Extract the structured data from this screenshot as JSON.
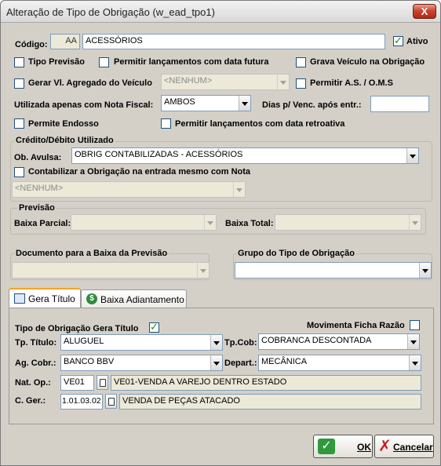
{
  "window": {
    "title": "Alteração de Tipo de Obrigação (w_ead_tpo1)",
    "close_glyph": "X"
  },
  "codigo": {
    "label": "Código:",
    "code": "AA",
    "description": "ACESSÓRIOS"
  },
  "ativo": {
    "label": "Ativo",
    "checked": true
  },
  "checks_row1": {
    "tipo_previsao": {
      "label": "Tipo Previsão",
      "checked": false
    },
    "permitir_futura": {
      "label": "Permitir lançamentos com data futura",
      "checked": false
    },
    "grava_veiculo": {
      "label": "Grava Veículo na Obrigação",
      "checked": false
    }
  },
  "gerar_vl": {
    "label": "Gerar Vl. Agregado do Veículo",
    "checked": false,
    "combo_value": "<NENHUM>"
  },
  "permitir_as": {
    "label": "Permitir A.S. / O.M.S",
    "checked": false
  },
  "nota_fiscal": {
    "label": "Utilizada apenas com Nota Fiscal:",
    "value": "AMBOS"
  },
  "dias_venc": {
    "label": "Dias p/ Venc. após entr.:",
    "value": ""
  },
  "permite_endosso": {
    "label": "Permite Endosso",
    "checked": false
  },
  "permitir_retroativa": {
    "label": "Permitir lançamentos com data retroativa",
    "checked": false
  },
  "credito": {
    "group_label": "Crédito/Débito Utilizado",
    "ob_avulsa_label": "Ob. Avulsa:",
    "ob_avulsa_value": "OBRIG CONTABILIZADAS - ACESSÓRIOS",
    "contabilizar_label": "Contabilizar a Obrigação na entrada mesmo com Nota",
    "contabilizar_checked": false,
    "nenhum_value": "<NENHUM>"
  },
  "previsao": {
    "group_label": "Previsão",
    "baixa_parcial_label": "Baixa Parcial:",
    "baixa_total_label": "Baixa Total:"
  },
  "documento_baixa": {
    "label": "Documento para a Baixa da Previsão"
  },
  "grupo_tipo": {
    "label": "Grupo do Tipo de Obrigação"
  },
  "tabs": [
    {
      "label": "Gera Título",
      "active": true
    },
    {
      "label": "Baixa Adiantamento",
      "active": false
    }
  ],
  "gera_titulo": {
    "tipo_label": "Tipo de Obrigação Gera Título",
    "tipo_checked": true,
    "movimenta_label": "Movimenta Ficha Razão",
    "movimenta_checked": false,
    "tp_titulo_label": "Tp. Título:",
    "tp_titulo_value": "ALUGUEL",
    "tp_cob_label": "Tp.Cob:",
    "tp_cob_value": "COBRANCA DESCONTADA",
    "ag_cobr_label": "Ag. Cobr.:",
    "ag_cobr_value": "BANCO BBV",
    "depart_label": "Depart.:",
    "depart_value": "MECÂNICA",
    "nat_op_label": "Nat. Op.:",
    "nat_op_code": "VE01",
    "nat_op_desc": "VE01-VENDA A VAREJO DENTRO ESTADO",
    "c_ger_label": "C. Ger.:",
    "c_ger_code": "1.01.03.02",
    "c_ger_desc": "VENDA DE PEÇAS ATACADO"
  },
  "buttons": {
    "ok": "OK",
    "cancelar": "Cancelar"
  },
  "colors": {
    "titlebar": "#e6e6e6",
    "close": "#c9442e",
    "dialog": "#d4d0c8",
    "check_mark": "#1c8c1c"
  }
}
